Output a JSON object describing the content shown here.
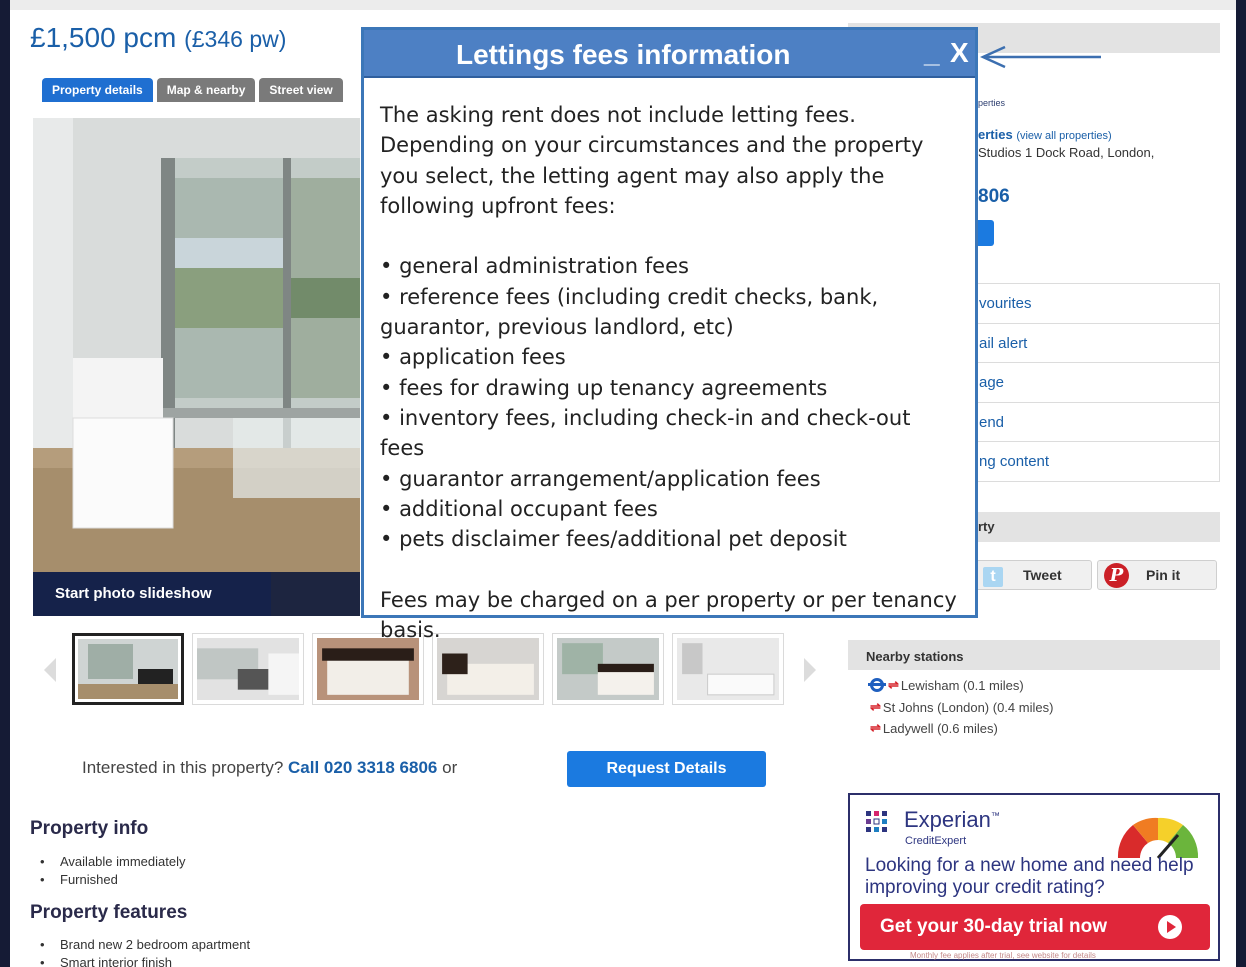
{
  "listing": {
    "price": "£1,500 pcm",
    "price_weekly": "(£346 pw)",
    "tabs": [
      {
        "label": "Property details",
        "active": true
      },
      {
        "label": "Map & nearby",
        "active": false
      },
      {
        "label": "Street view",
        "active": false
      }
    ],
    "slideshow_label": "Start photo slideshow",
    "interest_text": "Interested in this property?",
    "call_text": "Call 020 3318 6806",
    "or_text": "or",
    "request_label": "Request Details",
    "info_title": "Property info",
    "info_items": [
      "Available immediately",
      "Furnished"
    ],
    "features_title": "Property features",
    "feature_items": [
      "Brand new 2 bedroom apartment",
      "Smart interior finish"
    ]
  },
  "agent": {
    "logo_text": "perties",
    "name": "erties",
    "view_all": "(view all properties)",
    "address": "Studios 1 Dock Road, London,",
    "phone": "806",
    "actions": [
      "vourites",
      "ail alert",
      "age",
      "end",
      "ng content"
    ],
    "share_title": "rty",
    "tweet_label": "Tweet",
    "pin_label": "Pin it"
  },
  "stations": {
    "title": "Nearby stations",
    "items": [
      {
        "name": "Lewisham (0.1 miles)",
        "tube": true
      },
      {
        "name": "St Johns (London) (0.4 miles)",
        "tube": false
      },
      {
        "name": "Ladywell (0.6 miles)",
        "tube": false
      }
    ]
  },
  "ad": {
    "brand": "Experian",
    "brand_mark": "™",
    "sub": "CreditExpert",
    "headline": "Looking for a new home and need help improving your credit rating?",
    "cta": "Get your 30-day trial now",
    "small_print": "Monthly fee applies after trial, see website for details"
  },
  "modal": {
    "title": "Lettings fees information",
    "minimize": "_",
    "close": "X",
    "intro": "The asking rent does not include letting fees. Depending on your circumstances and the property you select, the letting agent may also apply the following upfront fees:",
    "fees": [
      "general administration fees",
      "reference fees (including credit checks, bank, guarantor, previous landlord, etc)",
      "application fees",
      "fees for drawing up tenancy agreements",
      "inventory fees, including check-in and check-out fees",
      "guarantor arrangement/application fees",
      "additional occupant fees",
      "pets disclaimer fees/additional pet deposit"
    ],
    "footer": "Fees may be charged on a per property or per tenancy basis."
  },
  "colors": {
    "brand_blue": "#1a5fa8",
    "modal_header": "#4d80c4",
    "button_blue": "#1b7ae0",
    "cta_red": "#e0263a"
  }
}
